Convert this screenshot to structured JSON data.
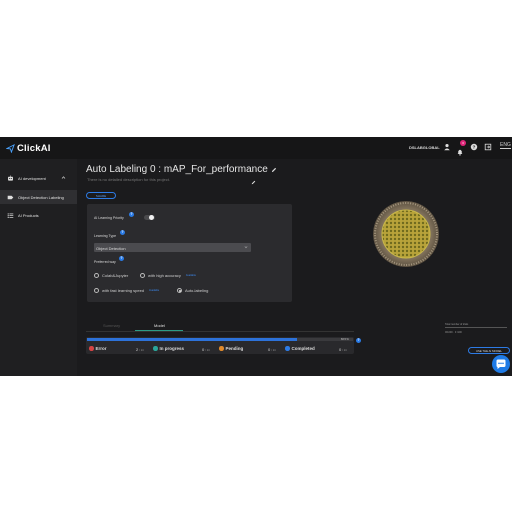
{
  "app": {
    "logo_text": "ClickAI",
    "user_name": "DSLABGLOBAL",
    "notification_count": "3",
    "language": "ENG"
  },
  "sidebar": {
    "items": [
      {
        "label": "AI development",
        "icon": "robot-icon",
        "expanded": true
      },
      {
        "label": "Object Detection Labeling",
        "icon": "label-icon",
        "active": true
      },
      {
        "label": "AI Products",
        "icon": "list-icon"
      }
    ]
  },
  "main": {
    "title": "Auto Labeling 0 : mAP_For_performance",
    "description": "There is no detailed description for this project.",
    "share_label": "SHARE"
  },
  "form": {
    "priority_label": "AI Learning Priority",
    "priority_on": false,
    "learning_type_label": "Learning Type",
    "learning_type_value": "Object Detection",
    "preferred_label": "Preferred way",
    "options": [
      {
        "label": "Colab&Jupyter",
        "tag": "",
        "selected": false
      },
      {
        "label": "with high accuracy",
        "tag": "Available",
        "selected": false
      },
      {
        "label": "with fast learning speed",
        "tag": "Available",
        "selected": false
      },
      {
        "label": "Auto-labeling",
        "tag": "",
        "selected": true
      }
    ]
  },
  "tabs": [
    {
      "label": "Summary",
      "active": false
    },
    {
      "label": "Model",
      "active": true
    }
  ],
  "side_info": {
    "note": "Total number of trials",
    "sub_note": "0/1000 · 0 /100"
  },
  "status": {
    "progress_pct": 79,
    "progress_label": "83.5 %",
    "progress_sub": "0 / 3",
    "items": [
      {
        "label": "Error",
        "count": "2",
        "unit": "/ 14",
        "color": "#d64545"
      },
      {
        "label": "In progress",
        "count": "0",
        "unit": "/ 14",
        "color": "#2aa59a"
      },
      {
        "label": "Pending",
        "count": "0",
        "unit": "/ 14",
        "color": "#e08a2c"
      },
      {
        "label": "Completed",
        "count": "0",
        "unit": "/ 14",
        "color": "#2d7be5"
      }
    ]
  },
  "use_button_label": "USE THE AI MODEL",
  "colors": {
    "accent": "#2d7be5",
    "background": "#1b1b1d",
    "panel": "#2b2b2e"
  }
}
